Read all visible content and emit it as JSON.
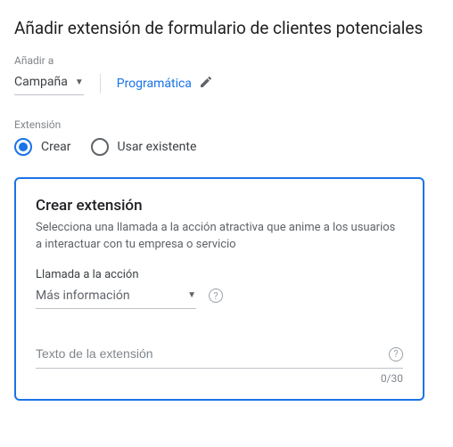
{
  "title": "Añadir extensión de formulario de clientes potenciales",
  "addTo": {
    "label": "Añadir a",
    "value": "Campaña"
  },
  "programmatic": {
    "label": "Programática"
  },
  "extension": {
    "label": "Extensión",
    "create": "Crear",
    "existing": "Usar existente"
  },
  "card": {
    "title": "Crear extensión",
    "desc": "Selecciona una llamada a la acción atractiva que anime a los usuarios a interactuar con tu empresa o servicio",
    "ctaLabel": "Llamada a la acción",
    "ctaValue": "Más información",
    "textPlaceholder": "Texto de la extensión",
    "counter": "0/30"
  }
}
